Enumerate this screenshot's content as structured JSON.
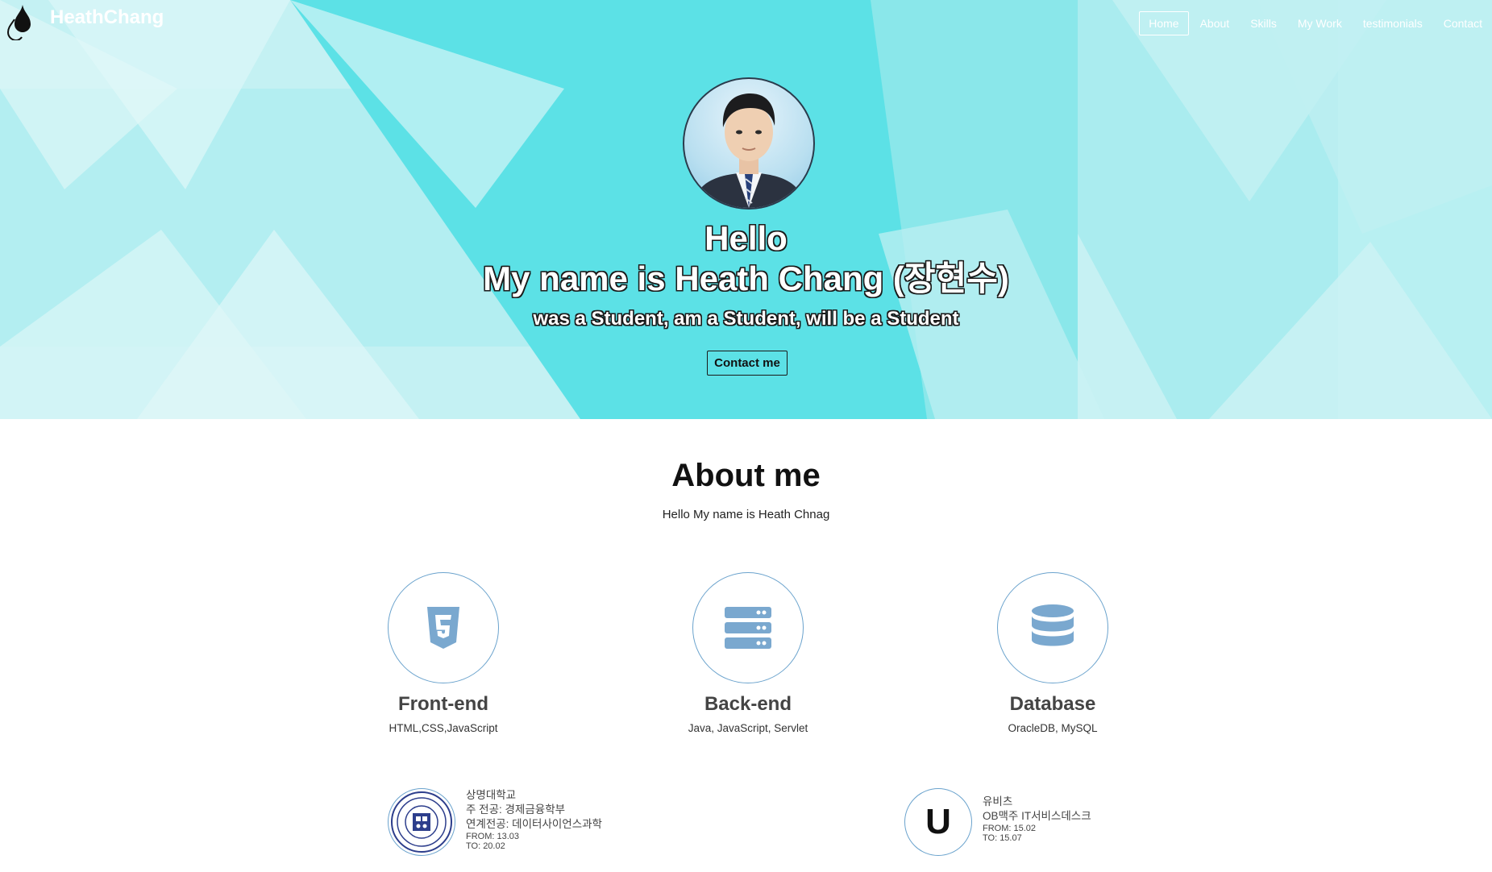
{
  "brand": {
    "name": "HeathChang",
    "logo_icon": "drop-icon"
  },
  "nav": {
    "items": [
      {
        "label": "Home",
        "active": true
      },
      {
        "label": "About",
        "active": false
      },
      {
        "label": "Skills",
        "active": false
      },
      {
        "label": "My Work",
        "active": false
      },
      {
        "label": "testimonials",
        "active": false
      },
      {
        "label": "Contact",
        "active": false
      }
    ]
  },
  "hero": {
    "greeting": "Hello",
    "name_line": "My name is Heath Chang (장현수)",
    "tagline": "was a Student, am a Student, will be a Student",
    "contact_button": "Contact me"
  },
  "about": {
    "title": "About me",
    "subtitle": "Hello My name is Heath Chnag",
    "skills": [
      {
        "icon": "html5-icon",
        "name": "Front-end",
        "desc": "HTML,CSS,JavaScript"
      },
      {
        "icon": "server-icon",
        "name": "Back-end",
        "desc": "Java, JavaScript, Servlet"
      },
      {
        "icon": "database-icon",
        "name": "Database",
        "desc": "OracleDB, MySQL"
      }
    ]
  },
  "education": [
    {
      "logo_icon": "university-seal-icon",
      "name": "상명대학교",
      "major": "주 전공: 경제금융학부",
      "minor": "연계전공: 데이터사이언스과학",
      "from": "FROM: 13.03",
      "to": "TO: 20.02"
    },
    {
      "logo_letter": "U",
      "name": "유비츠",
      "role": "OB맥주 IT서비스데스크",
      "from": "FROM: 15.02",
      "to": "TO: 15.07"
    }
  ],
  "colors": {
    "hero_light": "#c4f1f3",
    "hero_mid": "#a2ecee",
    "hero_strong": "#5ce1e6",
    "icon_blue": "#7aa8cf",
    "circle_border": "#6ba3cd"
  }
}
